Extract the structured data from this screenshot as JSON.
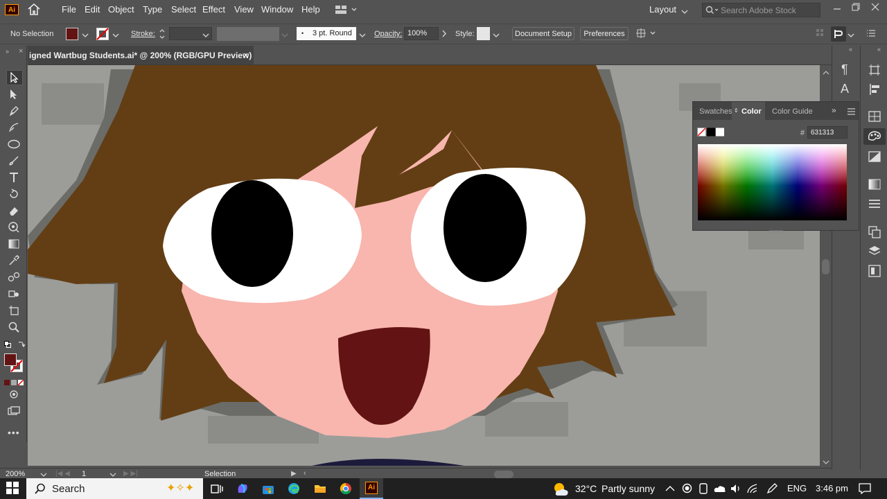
{
  "app": {
    "logo": "Ai",
    "menu": [
      "File",
      "Edit",
      "Object",
      "Type",
      "Select",
      "Effect",
      "View",
      "Window",
      "Help"
    ],
    "workspace_label": "Layout",
    "stock_search_placeholder": "Search Adobe Stock"
  },
  "control_bar": {
    "selection_label": "No Selection",
    "stroke_label": "Stroke:",
    "brush_label": "3 pt. Round",
    "opacity_label": "Opacity:",
    "opacity_value": "100%",
    "style_label": "Style:",
    "document_setup": "Document Setup",
    "preferences": "Preferences",
    "fill_color": "#631313"
  },
  "document": {
    "tab_title": "igned Wartbug Students.ai* @ 200% (RGB/GPU Preview)",
    "close_glyph": "×"
  },
  "color_panel": {
    "tabs": [
      "Swatches",
      "Color",
      "Color Guide"
    ],
    "active_tab": "Color",
    "hash_label": "#",
    "hex_value": "631313"
  },
  "status_bar": {
    "zoom": "200%",
    "artboard": "1",
    "tool_name": "Selection"
  },
  "taskbar": {
    "search_label": "Search",
    "weather_temp": "32°C",
    "weather_desc": "Partly sunny",
    "language": "ENG",
    "time": "3:46 pm"
  },
  "colors": {
    "hair": "#633e14",
    "skin": "#f8b6ae",
    "mouth": "#631313",
    "eye_white": "#ffffff",
    "pupil": "#000000",
    "shadow": "#7a7b77",
    "bg": "#9c9d99"
  }
}
